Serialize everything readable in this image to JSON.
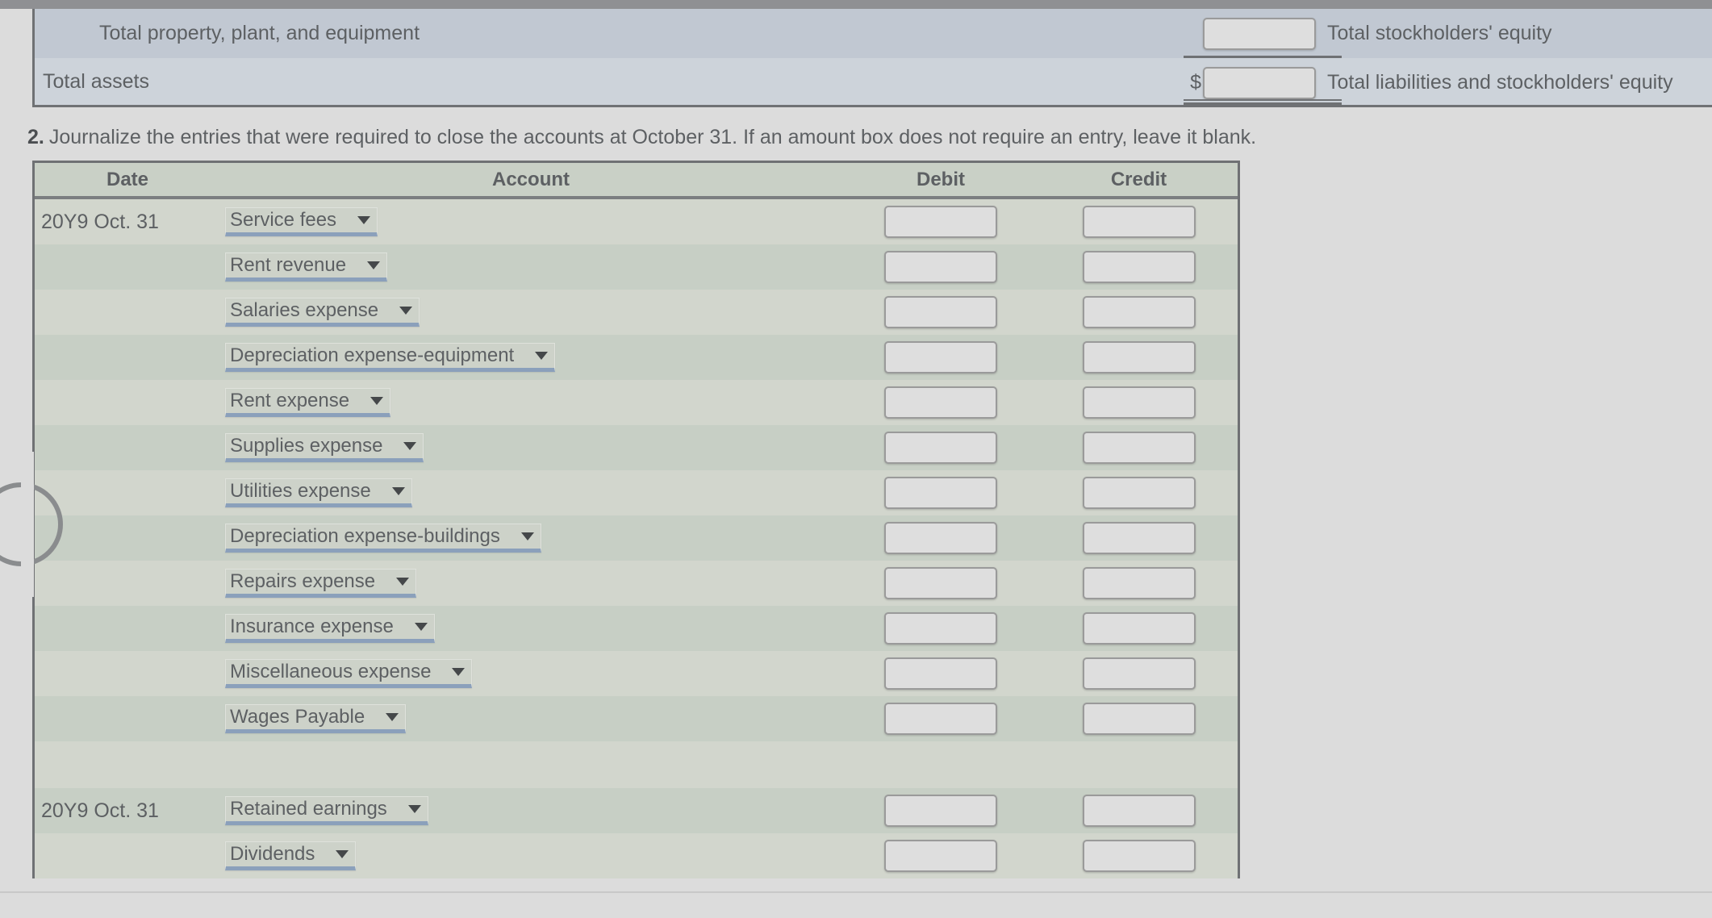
{
  "balance_sheet": {
    "rows": [
      {
        "label": "Total property, plant, and equipment",
        "dollar": "",
        "caption": "Total stockholders' equity",
        "rule": "single",
        "input_value": ""
      },
      {
        "label": "Total assets",
        "dollar": "$",
        "caption": "Total liabilities and stockholders' equity",
        "rule": "double",
        "input_value": ""
      }
    ]
  },
  "instruction": {
    "number": "2.",
    "text": "Journalize the entries that were required to close the accounts at October 31. If an amount box does not require an entry, leave it blank."
  },
  "journal": {
    "headers": {
      "date": "Date",
      "account": "Account",
      "debit": "Debit",
      "credit": "Credit"
    },
    "rows": [
      {
        "date": "20Y9 Oct. 31",
        "account": "Service fees",
        "debit": "",
        "credit": "",
        "spacer": false
      },
      {
        "date": "",
        "account": "Rent revenue",
        "debit": "",
        "credit": "",
        "spacer": false
      },
      {
        "date": "",
        "account": "Salaries expense",
        "debit": "",
        "credit": "",
        "spacer": false
      },
      {
        "date": "",
        "account": "Depreciation expense-equipment",
        "debit": "",
        "credit": "",
        "spacer": false
      },
      {
        "date": "",
        "account": "Rent expense",
        "debit": "",
        "credit": "",
        "spacer": false
      },
      {
        "date": "",
        "account": "Supplies expense",
        "debit": "",
        "credit": "",
        "spacer": false
      },
      {
        "date": "",
        "account": "Utilities expense",
        "debit": "",
        "credit": "",
        "spacer": false
      },
      {
        "date": "",
        "account": "Depreciation expense-buildings",
        "debit": "",
        "credit": "",
        "spacer": false
      },
      {
        "date": "",
        "account": "Repairs expense",
        "debit": "",
        "credit": "",
        "spacer": false
      },
      {
        "date": "",
        "account": "Insurance expense",
        "debit": "",
        "credit": "",
        "spacer": false
      },
      {
        "date": "",
        "account": "Miscellaneous expense",
        "debit": "",
        "credit": "",
        "spacer": false
      },
      {
        "date": "",
        "account": "Wages Payable",
        "debit": "",
        "credit": "",
        "spacer": false
      },
      {
        "date": "",
        "account": "",
        "debit": "",
        "credit": "",
        "spacer": true
      },
      {
        "date": "20Y9 Oct. 31",
        "account": "Retained earnings",
        "debit": "",
        "credit": "",
        "spacer": false
      },
      {
        "date": "",
        "account": "Dividends",
        "debit": "",
        "credit": "",
        "spacer": false
      }
    ]
  },
  "colors": {
    "page_background": "#dcdcdc",
    "top_bar": "#8f9093",
    "bs_row_dark": "#c1c8d2",
    "bs_row_light": "#cdd3da",
    "journal_header": "#c9d0c6",
    "journal_row_light": "#d2d6cd",
    "journal_row_dark": "#c7cfc5",
    "select_underline": "#8ba0bb",
    "input_fill": "#dedede",
    "text": "#5d6063",
    "border": "#6f7174"
  }
}
